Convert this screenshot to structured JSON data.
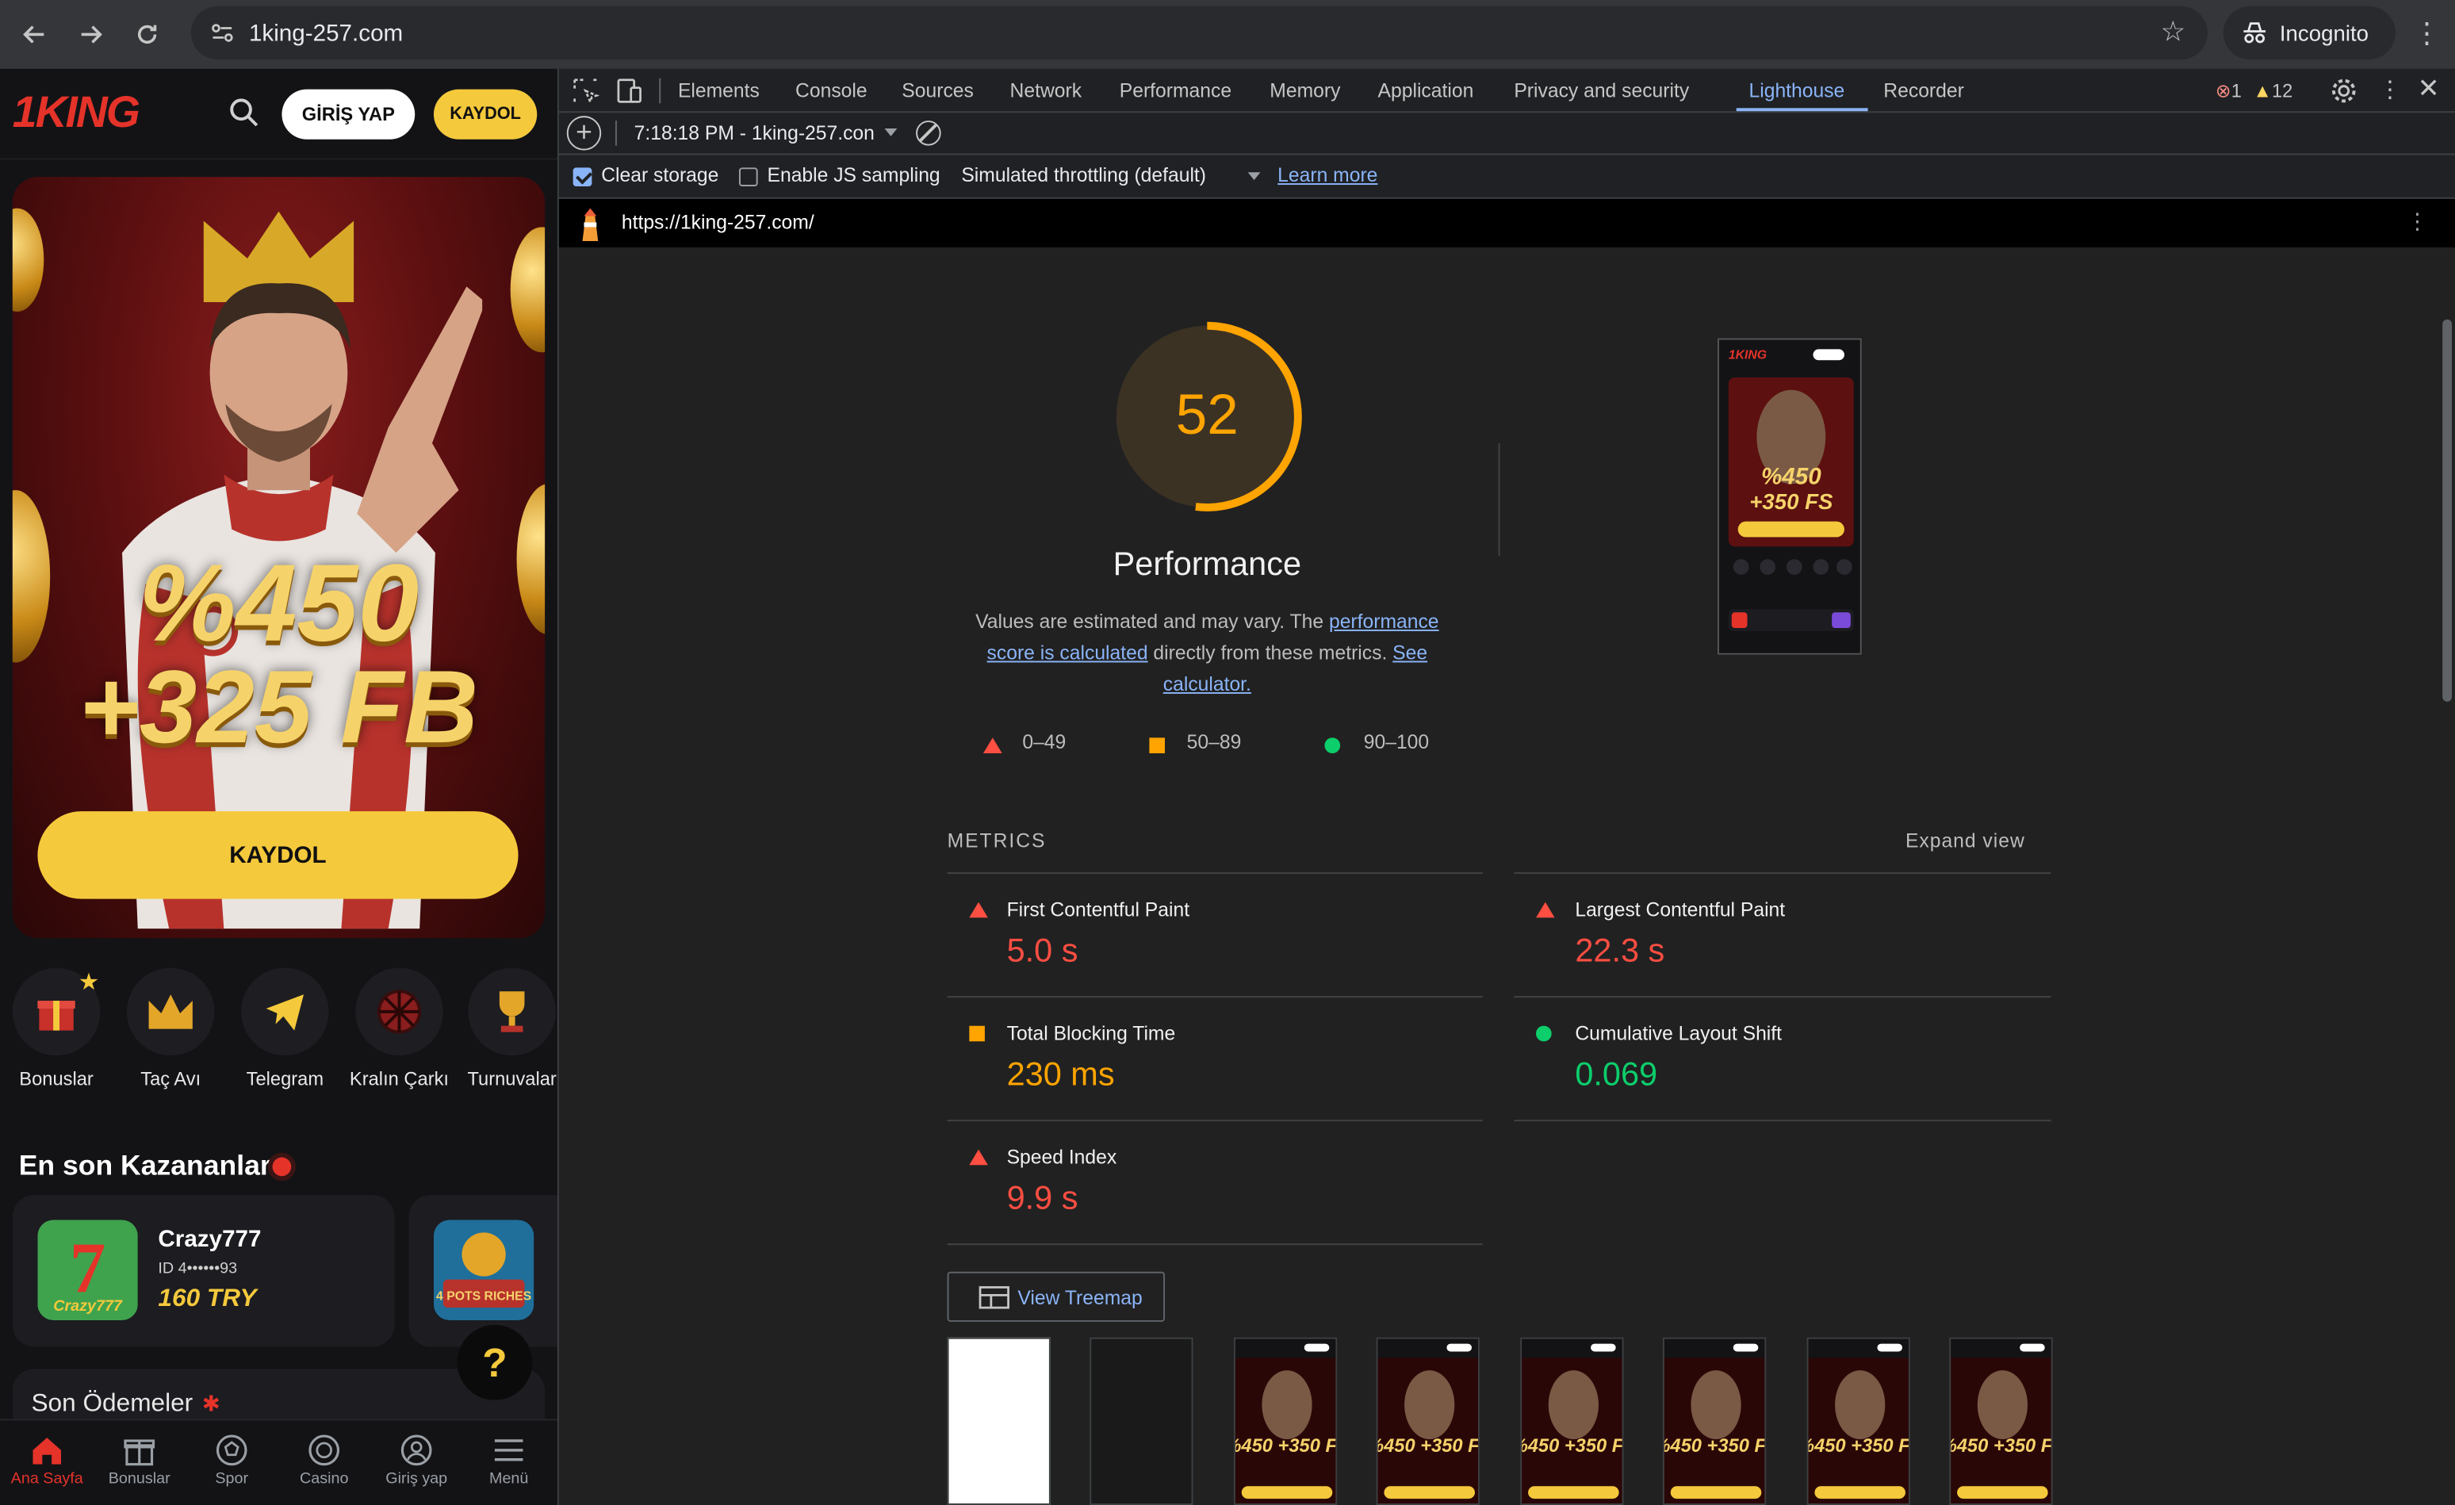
{
  "browser": {
    "url": "1king-257.com",
    "profile_label": "Incognito"
  },
  "mobile": {
    "login_label": "GİRİŞ YAP",
    "register_label": "KAYDOL",
    "logo_text": "1KING",
    "hero": {
      "promo_line1": "%450",
      "promo_line2": "+325 FB",
      "cta_label": "KAYDOL"
    },
    "categories": [
      {
        "label": "Bonuslar",
        "icon": "gift-icon"
      },
      {
        "label": "Taç Avı",
        "icon": "crown-icon"
      },
      {
        "label": "Telegram",
        "icon": "telegram-icon"
      },
      {
        "label": "Kralın Çarkı",
        "icon": "wheel-icon"
      },
      {
        "label": "Turnuvalar",
        "icon": "trophy-icon"
      }
    ],
    "winners_title": "En son Kazananlar",
    "winners": [
      {
        "name": "Crazy777",
        "id": "ID 4••••••93",
        "amount": "160 TRY",
        "game_thumb_text": "Crazy777"
      },
      {
        "name": "",
        "id": "",
        "amount": "",
        "game_thumb_text": "4 POTS RICHES"
      }
    ],
    "help_label": "?",
    "payments_title": "Son Ödemeler",
    "tabbar": [
      {
        "label": "Ana Sayfa",
        "icon": "home-icon",
        "active": true
      },
      {
        "label": "Bonuslar",
        "icon": "gift-icon",
        "active": false
      },
      {
        "label": "Spor",
        "icon": "soccer-ball-icon",
        "active": false
      },
      {
        "label": "Casino",
        "icon": "casino-chip-icon",
        "active": false
      },
      {
        "label": "Giriş yap",
        "icon": "user-icon",
        "active": false
      },
      {
        "label": "Menü",
        "icon": "menu-icon",
        "active": false
      }
    ]
  },
  "devtools": {
    "tabs": [
      "Elements",
      "Console",
      "Sources",
      "Network",
      "Performance",
      "Memory",
      "Application",
      "Privacy and security",
      "Lighthouse",
      "Recorder"
    ],
    "active_tab": "Lighthouse",
    "error_count": "1",
    "warning_count": "12",
    "report_select": "7:18:18 PM - 1king-257.con",
    "options": {
      "clear_storage": "Clear storage",
      "clear_storage_checked": true,
      "js_sampling": "Enable JS sampling",
      "js_sampling_checked": false,
      "throttling": "Simulated throttling (default)",
      "learn_more": "Learn more"
    },
    "report_url": "https://1king-257.com/"
  },
  "lighthouse": {
    "score": "52",
    "score_fraction": 0.52,
    "category_title": "Performance",
    "desc_pre": "Values are estimated and may vary. The ",
    "desc_link1": "performance score is calculated",
    "desc_mid": " directly from these metrics. ",
    "desc_link2": "See calculator.",
    "legend": [
      {
        "range": "0–49",
        "color": "#ff4e42"
      },
      {
        "range": "50–89",
        "color": "#ffa400"
      },
      {
        "range": "90–100",
        "color": "#0cce6b"
      }
    ],
    "metrics_header": "METRICS",
    "expand_label": "Expand view",
    "metrics": [
      {
        "label": "First Contentful Paint",
        "value": "5.0 s",
        "rating": "fail"
      },
      {
        "label": "Largest Contentful Paint",
        "value": "22.3 s",
        "rating": "fail"
      },
      {
        "label": "Total Blocking Time",
        "value": "230 ms",
        "rating": "average"
      },
      {
        "label": "Cumulative Layout Shift",
        "value": "0.069",
        "rating": "pass"
      },
      {
        "label": "Speed Index",
        "value": "9.9 s",
        "rating": "fail"
      }
    ],
    "treemap_label": "View Treemap",
    "filmstrip_promo": "%450 +350 FS"
  },
  "colors": {
    "fail": "#ff4e42",
    "average": "#ffa400",
    "pass": "#0cce6b",
    "brand_yellow": "#f5c93c",
    "brand_red": "#e5332a",
    "link": "#8ab4f8"
  }
}
